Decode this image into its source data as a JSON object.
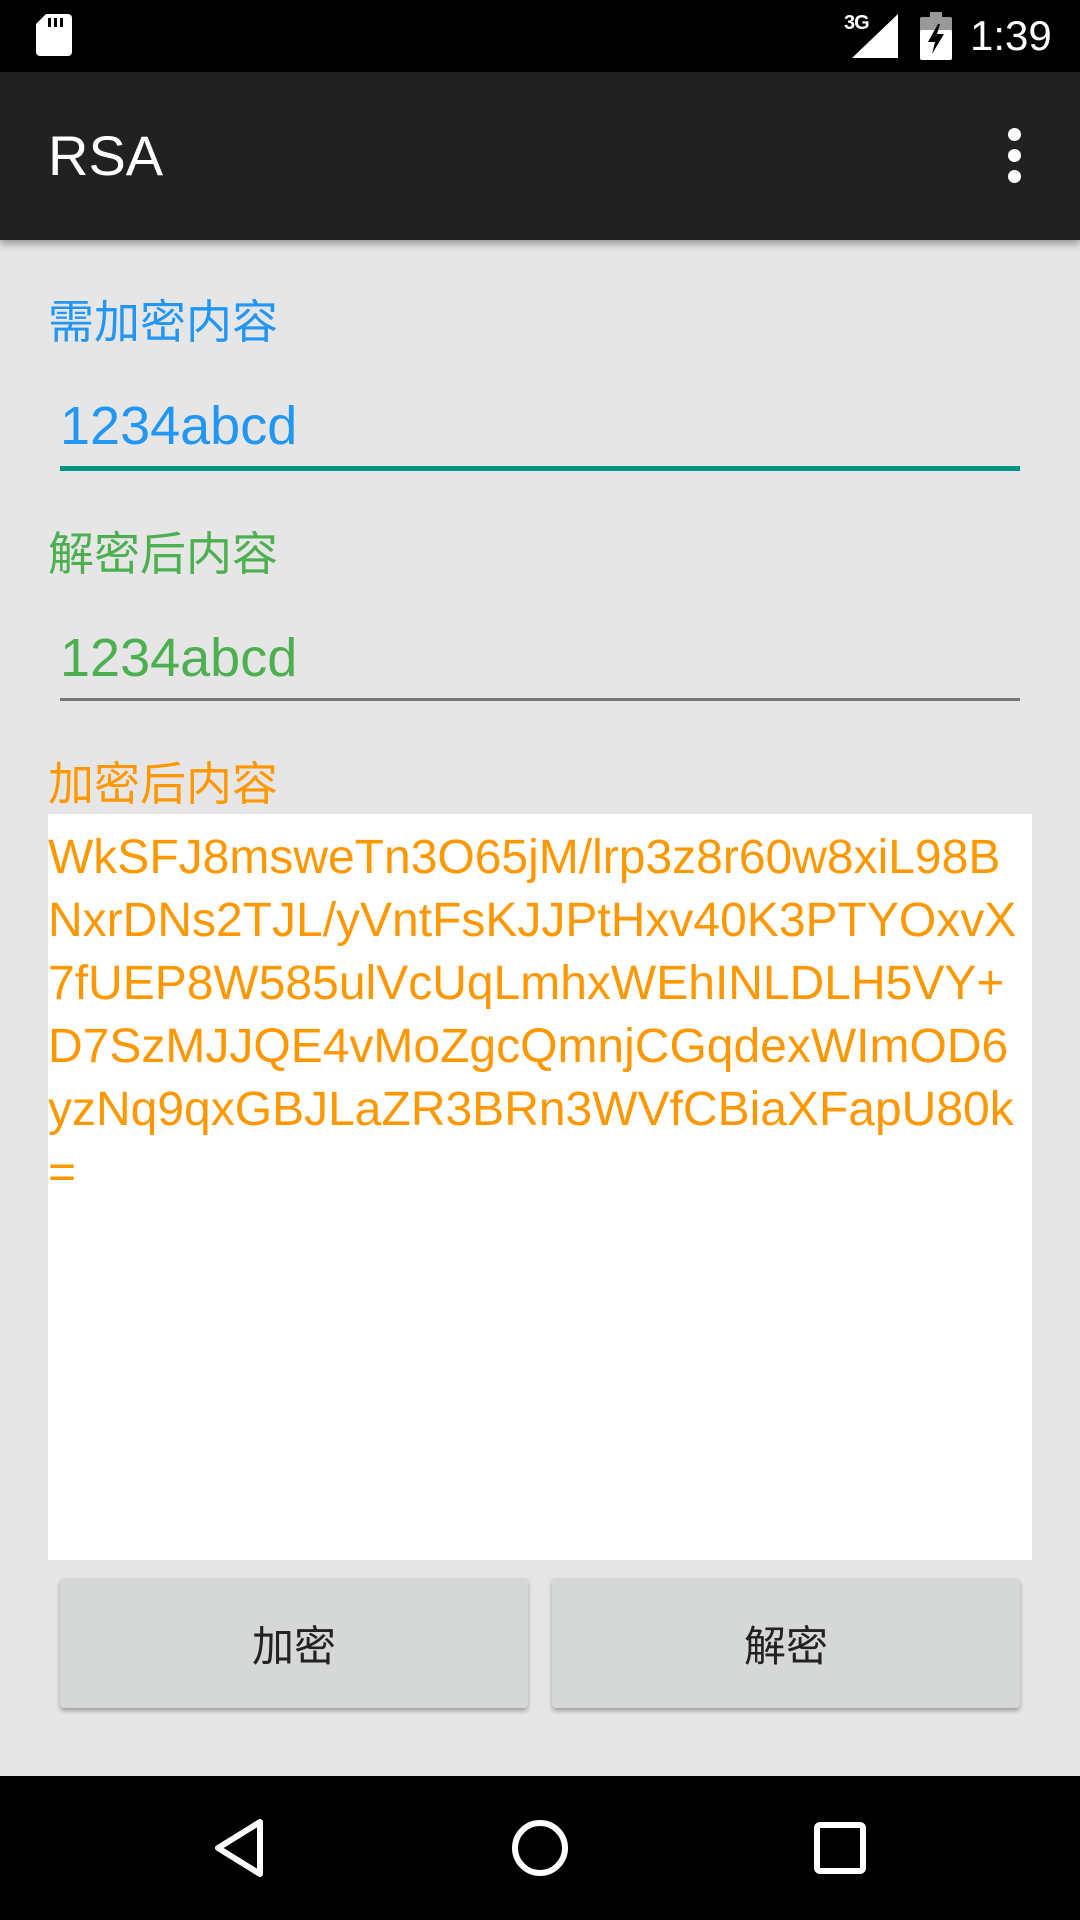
{
  "status_bar": {
    "network_type": "3G",
    "time": "1:39",
    "icons": [
      "sd-card-icon",
      "signal-icon",
      "battery-charging-icon"
    ]
  },
  "action_bar": {
    "title": "RSA",
    "overflow_icon": "more-vert-icon"
  },
  "form": {
    "plain_label": "需加密内容",
    "plain_value": "1234abcd",
    "decrypted_label": "解密后内容",
    "decrypted_value": "1234abcd",
    "encrypted_label": "加密后内容",
    "encrypted_value": "WkSFJ8msweTn3O65jM/lrp3z8r60w8xiL98BNxrDNs2TJL/yVntFsKJJPtHxv40K3PTYOxvX7fUEP8W585ulVcUqLmhxWEhINLDLH5VY+D7SzMJJQE4vMoZgcQmnjCGqdexWImOD6yzNq9qxGBJLaZR3BRn3WVfCBiaXFapU80k="
  },
  "buttons": {
    "encrypt": "加密",
    "decrypt": "解密"
  },
  "colors": {
    "plain": "#2196f3",
    "decrypted": "#4caf50",
    "encrypted": "#ff9800",
    "accent_underline": "#009688"
  },
  "nav_bar": {
    "icons": [
      "back-icon",
      "home-icon",
      "recents-icon"
    ]
  }
}
